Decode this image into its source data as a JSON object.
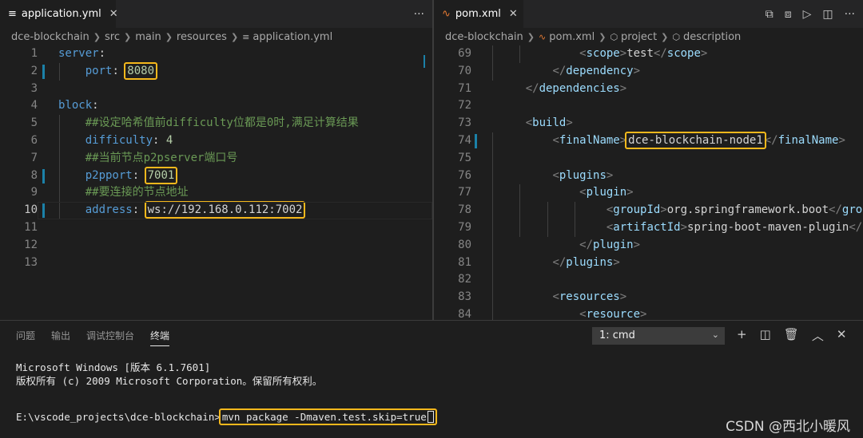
{
  "left_editor": {
    "tab": {
      "label": "application.yml",
      "icon": "yaml-file-icon"
    },
    "more": "···",
    "breadcrumb": [
      "dce-blockchain",
      "src",
      "main",
      "resources",
      "application.yml"
    ],
    "lines": [
      {
        "num": "1",
        "indent": "",
        "key": "server",
        "colon": ":",
        "value": "",
        "comment": ""
      },
      {
        "num": "2",
        "indent": "    ",
        "key": "port",
        "colon": ": ",
        "value": "8080",
        "comment": ""
      },
      {
        "num": "3",
        "indent": "",
        "key": "",
        "colon": "",
        "value": "",
        "comment": ""
      },
      {
        "num": "4",
        "indent": "",
        "key": "block",
        "colon": ":",
        "value": "",
        "comment": ""
      },
      {
        "num": "5",
        "indent": "    ",
        "key": "",
        "colon": "",
        "value": "",
        "comment": "##设定哈希值前difficulty位都是0时,满足计算结果"
      },
      {
        "num": "6",
        "indent": "    ",
        "key": "difficulty",
        "colon": ": ",
        "value": "4",
        "comment": ""
      },
      {
        "num": "7",
        "indent": "    ",
        "key": "",
        "colon": "",
        "value": "",
        "comment": "##当前节点p2pserver端口号"
      },
      {
        "num": "8",
        "indent": "    ",
        "key": "p2pport",
        "colon": ": ",
        "value": "7001",
        "comment": ""
      },
      {
        "num": "9",
        "indent": "    ",
        "key": "",
        "colon": "",
        "value": "",
        "comment": "##要连接的节点地址"
      },
      {
        "num": "10",
        "indent": "    ",
        "key": "address",
        "colon": ": ",
        "value": "ws://192.168.0.112:7002",
        "comment": ""
      },
      {
        "num": "11",
        "indent": "",
        "key": "",
        "colon": "",
        "value": "",
        "comment": ""
      },
      {
        "num": "12",
        "indent": "",
        "key": "",
        "colon": "",
        "value": "",
        "comment": ""
      },
      {
        "num": "13",
        "indent": "",
        "key": "",
        "colon": "",
        "value": "",
        "comment": ""
      }
    ]
  },
  "right_editor": {
    "tab": {
      "label": "pom.xml",
      "icon": "xml-file-icon"
    },
    "breadcrumb": [
      "dce-blockchain",
      "pom.xml",
      "project",
      "description"
    ],
    "lines": [
      {
        "num": "69",
        "text": "            <scope>test</scope>"
      },
      {
        "num": "70",
        "text": "        </dependency>"
      },
      {
        "num": "71",
        "text": "    </dependencies>"
      },
      {
        "num": "72",
        "text": ""
      },
      {
        "num": "73",
        "text": "    <build>"
      },
      {
        "num": "74",
        "text": "        <finalName>dce-blockchain-node1</finalName>"
      },
      {
        "num": "75",
        "text": ""
      },
      {
        "num": "76",
        "text": "        <plugins>"
      },
      {
        "num": "77",
        "text": "            <plugin>"
      },
      {
        "num": "78",
        "text": "                <groupId>org.springframework.boot</groupId>"
      },
      {
        "num": "79",
        "text": "                <artifactId>spring-boot-maven-plugin</artifactId>"
      },
      {
        "num": "80",
        "text": "            </plugin>"
      },
      {
        "num": "81",
        "text": "        </plugins>"
      },
      {
        "num": "82",
        "text": ""
      },
      {
        "num": "83",
        "text": "        <resources>"
      },
      {
        "num": "84",
        "text": "            <resource>"
      }
    ]
  },
  "panel": {
    "tabs": [
      "问题",
      "输出",
      "调试控制台",
      "终端"
    ],
    "active_tab": "终端",
    "terminal_select": "1: cmd",
    "terminal_lines": [
      "Microsoft Windows [版本 6.1.7601]",
      "版权所有 (c) 2009 Microsoft Corporation。保留所有权利。",
      "",
      "E:\\vscode_projects\\dce-blockchain>"
    ],
    "command": "mvn package -Dmaven.test.skip=true"
  },
  "watermark": "CSDN @西北小暖风",
  "colors": {
    "highlight_box": "#f5b81c",
    "keyword": "#569cd6",
    "number": "#b5cea8",
    "comment": "#6a9955",
    "attr": "#9cdcfe"
  }
}
